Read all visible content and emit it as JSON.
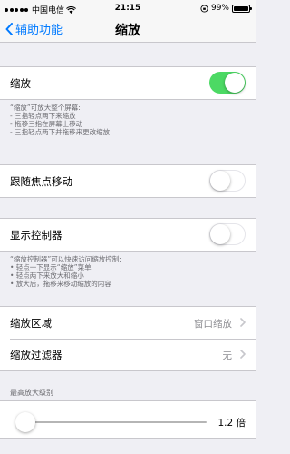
{
  "status_bar": {
    "carrier": "中国电信",
    "time": "21:15",
    "battery": "99%",
    "battery_level": 0.99
  },
  "nav": {
    "back_label": "辅助功能",
    "title": "缩放"
  },
  "zoom": {
    "label": "缩放",
    "enabled": true,
    "footnote": [
      "“缩放”可放大整个屏幕:",
      "- 三指轻点两下来缩放",
      "- 拖移三指在屏幕上移动",
      "- 三指轻点两下并拖移来更改缩放"
    ]
  },
  "follow_focus": {
    "label": "跟随焦点移动",
    "enabled": false
  },
  "show_controller": {
    "label": "显示控制器",
    "enabled": false,
    "footnote": [
      "“缩放控制器”可以快速访问缩放控制:",
      "• 轻点一下显示“缩放”菜单",
      "• 轻点两下来放大和缩小",
      "• 放大后，拖移来移动缩放的内容"
    ]
  },
  "zoom_region": {
    "label": "缩放区域",
    "value": "窗口缩放"
  },
  "zoom_filter": {
    "label": "缩放过滤器",
    "value": "无"
  },
  "max_zoom": {
    "header": "最高放大级别",
    "value_label": "1.2 倍",
    "slider_fraction": 0.0
  },
  "colors": {
    "accent": "#007aff",
    "switch_on": "#4cd964",
    "background": "#efeff4"
  }
}
